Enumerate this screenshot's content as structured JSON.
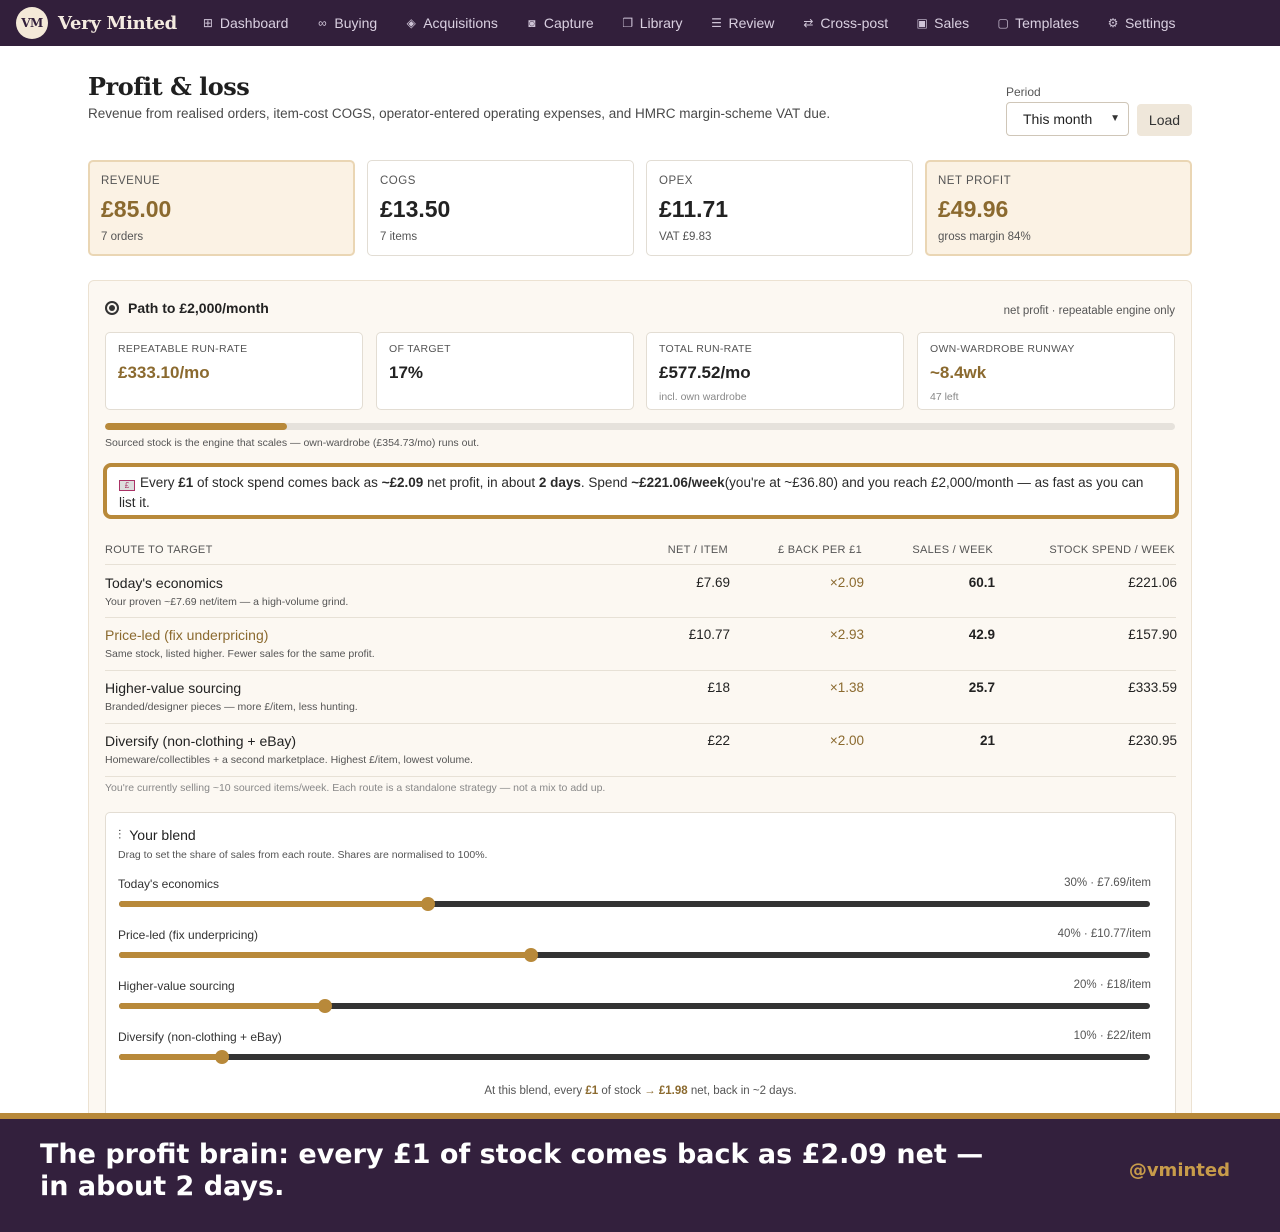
{
  "app": {
    "logo_initials": "VM",
    "name": "Very Minted"
  },
  "nav": [
    {
      "label": "Dashboard",
      "icon": "grid-icon"
    },
    {
      "label": "Buying",
      "icon": "binoculars-icon"
    },
    {
      "label": "Acquisitions",
      "icon": "box-icon"
    },
    {
      "label": "Capture",
      "icon": "camera-icon"
    },
    {
      "label": "Library",
      "icon": "images-icon"
    },
    {
      "label": "Review",
      "icon": "checklist-icon"
    },
    {
      "label": "Cross-post",
      "icon": "repeat-icon"
    },
    {
      "label": "Sales",
      "icon": "bag-icon"
    },
    {
      "label": "Templates",
      "icon": "message-icon"
    },
    {
      "label": "Settings",
      "icon": "gear-icon"
    }
  ],
  "header": {
    "title": "Profit & loss",
    "subtitle": "Revenue from realised orders, item-cost COGS, operator-entered operating expenses, and HMRC margin-scheme VAT due.",
    "period_label": "Period",
    "period_value": "This month",
    "load_label": "Load"
  },
  "kpis": [
    {
      "label": "Revenue",
      "value": "£85.00",
      "sub": "7 orders",
      "highlight": true
    },
    {
      "label": "COGS",
      "value": "£13.50",
      "sub": "7 items",
      "highlight": false
    },
    {
      "label": "Opex",
      "value": "£11.71",
      "sub": "VAT £9.83",
      "highlight": false
    },
    {
      "label": "Net profit",
      "value": "£49.96",
      "sub": "gross margin 84%",
      "highlight": true
    }
  ],
  "path": {
    "title": "Path to £2,000/month",
    "note": "net profit · repeatable engine only",
    "metrics": [
      {
        "label": "Repeatable run-rate",
        "value": "£333.10/mo",
        "sub": ""
      },
      {
        "label": "Of target",
        "value": "17%",
        "sub": ""
      },
      {
        "label": "Total run-rate",
        "value": "£577.52/mo",
        "sub": "incl. own wardrobe"
      },
      {
        "label": "Own-wardrobe runway",
        "value": "~8.4wk",
        "sub": "47 left"
      }
    ],
    "progress_fraction": 0.17,
    "progress_note": "Sourced stock is the engine that scales — own-wardrobe (£354.73/mo) runs out.",
    "callout": {
      "p1": "Every ",
      "b1": "£1",
      "p2": " of stock spend comes back as ",
      "b2": "~£2.09",
      "p3": " net profit, in about ",
      "b3": "2 days",
      "p4": ". Spend ",
      "b4": "~£221.06/week",
      "p5": "(you're at ~£36.80) and you reach £2,000/month — as fast as you can list it."
    }
  },
  "routes": {
    "headers": {
      "route": "Route to target",
      "net": "Net / item",
      "back": "£ back per £1",
      "sales": "Sales / week",
      "spend": "Stock spend / week"
    },
    "rows": [
      {
        "name": "Today's economics",
        "desc": "Your proven ~£7.69 net/item — a high-volume grind.",
        "net": "£7.69",
        "back": "×2.09",
        "sales": "60.1",
        "spend": "£221.06"
      },
      {
        "name": "Price-led (fix underpricing)",
        "desc": "Same stock, listed higher. Fewer sales for the same profit.",
        "net": "£10.77",
        "back": "×2.93",
        "sales": "42.9",
        "spend": "£157.90"
      },
      {
        "name": "Higher-value sourcing",
        "desc": "Branded/designer pieces — more £/item, less hunting.",
        "net": "£18",
        "back": "×1.38",
        "sales": "25.7",
        "spend": "£333.59"
      },
      {
        "name": "Diversify (non-clothing + eBay)",
        "desc": "Homeware/collectibles + a second marketplace. Highest £/item, lowest volume.",
        "net": "£22",
        "back": "×2.00",
        "sales": "21",
        "spend": "£230.95"
      }
    ],
    "footnote": "You're currently selling ~10 sourced items/week. Each route is a standalone strategy — not a mix to add up."
  },
  "blend": {
    "title": "Your blend",
    "subtitle": "Drag to set the share of sales from each route. Shares are normalised to 100%.",
    "sliders": [
      {
        "label": "Today's economics",
        "value_text": "30% · £7.69/item",
        "share": 0.3
      },
      {
        "label": "Price-led (fix underpricing)",
        "value_text": "40% · £10.77/item",
        "share": 0.4
      },
      {
        "label": "Higher-value sourcing",
        "value_text": "20% · £18/item",
        "share": 0.2
      },
      {
        "label": "Diversify (non-clothing + eBay)",
        "value_text": "10% · £22/item",
        "share": 0.1
      }
    ],
    "summary": {
      "p1": "At this blend, every ",
      "b1": "£1",
      "p2": " of stock ",
      "arrow": "→",
      "b2": "£1.98",
      "p3": " net, back in ~2 days."
    }
  },
  "banner": {
    "text": "The profit brain: every £1 of stock comes back as £2.09 net — in about 2 days.",
    "handle": "@vminted"
  },
  "colors": {
    "nav_bg": "#321f3b",
    "accent_gold": "#b8893a",
    "gold_text": "#8b6a2f",
    "panel_bg": "#fcf8f2",
    "banner_bg": "#33203d"
  }
}
